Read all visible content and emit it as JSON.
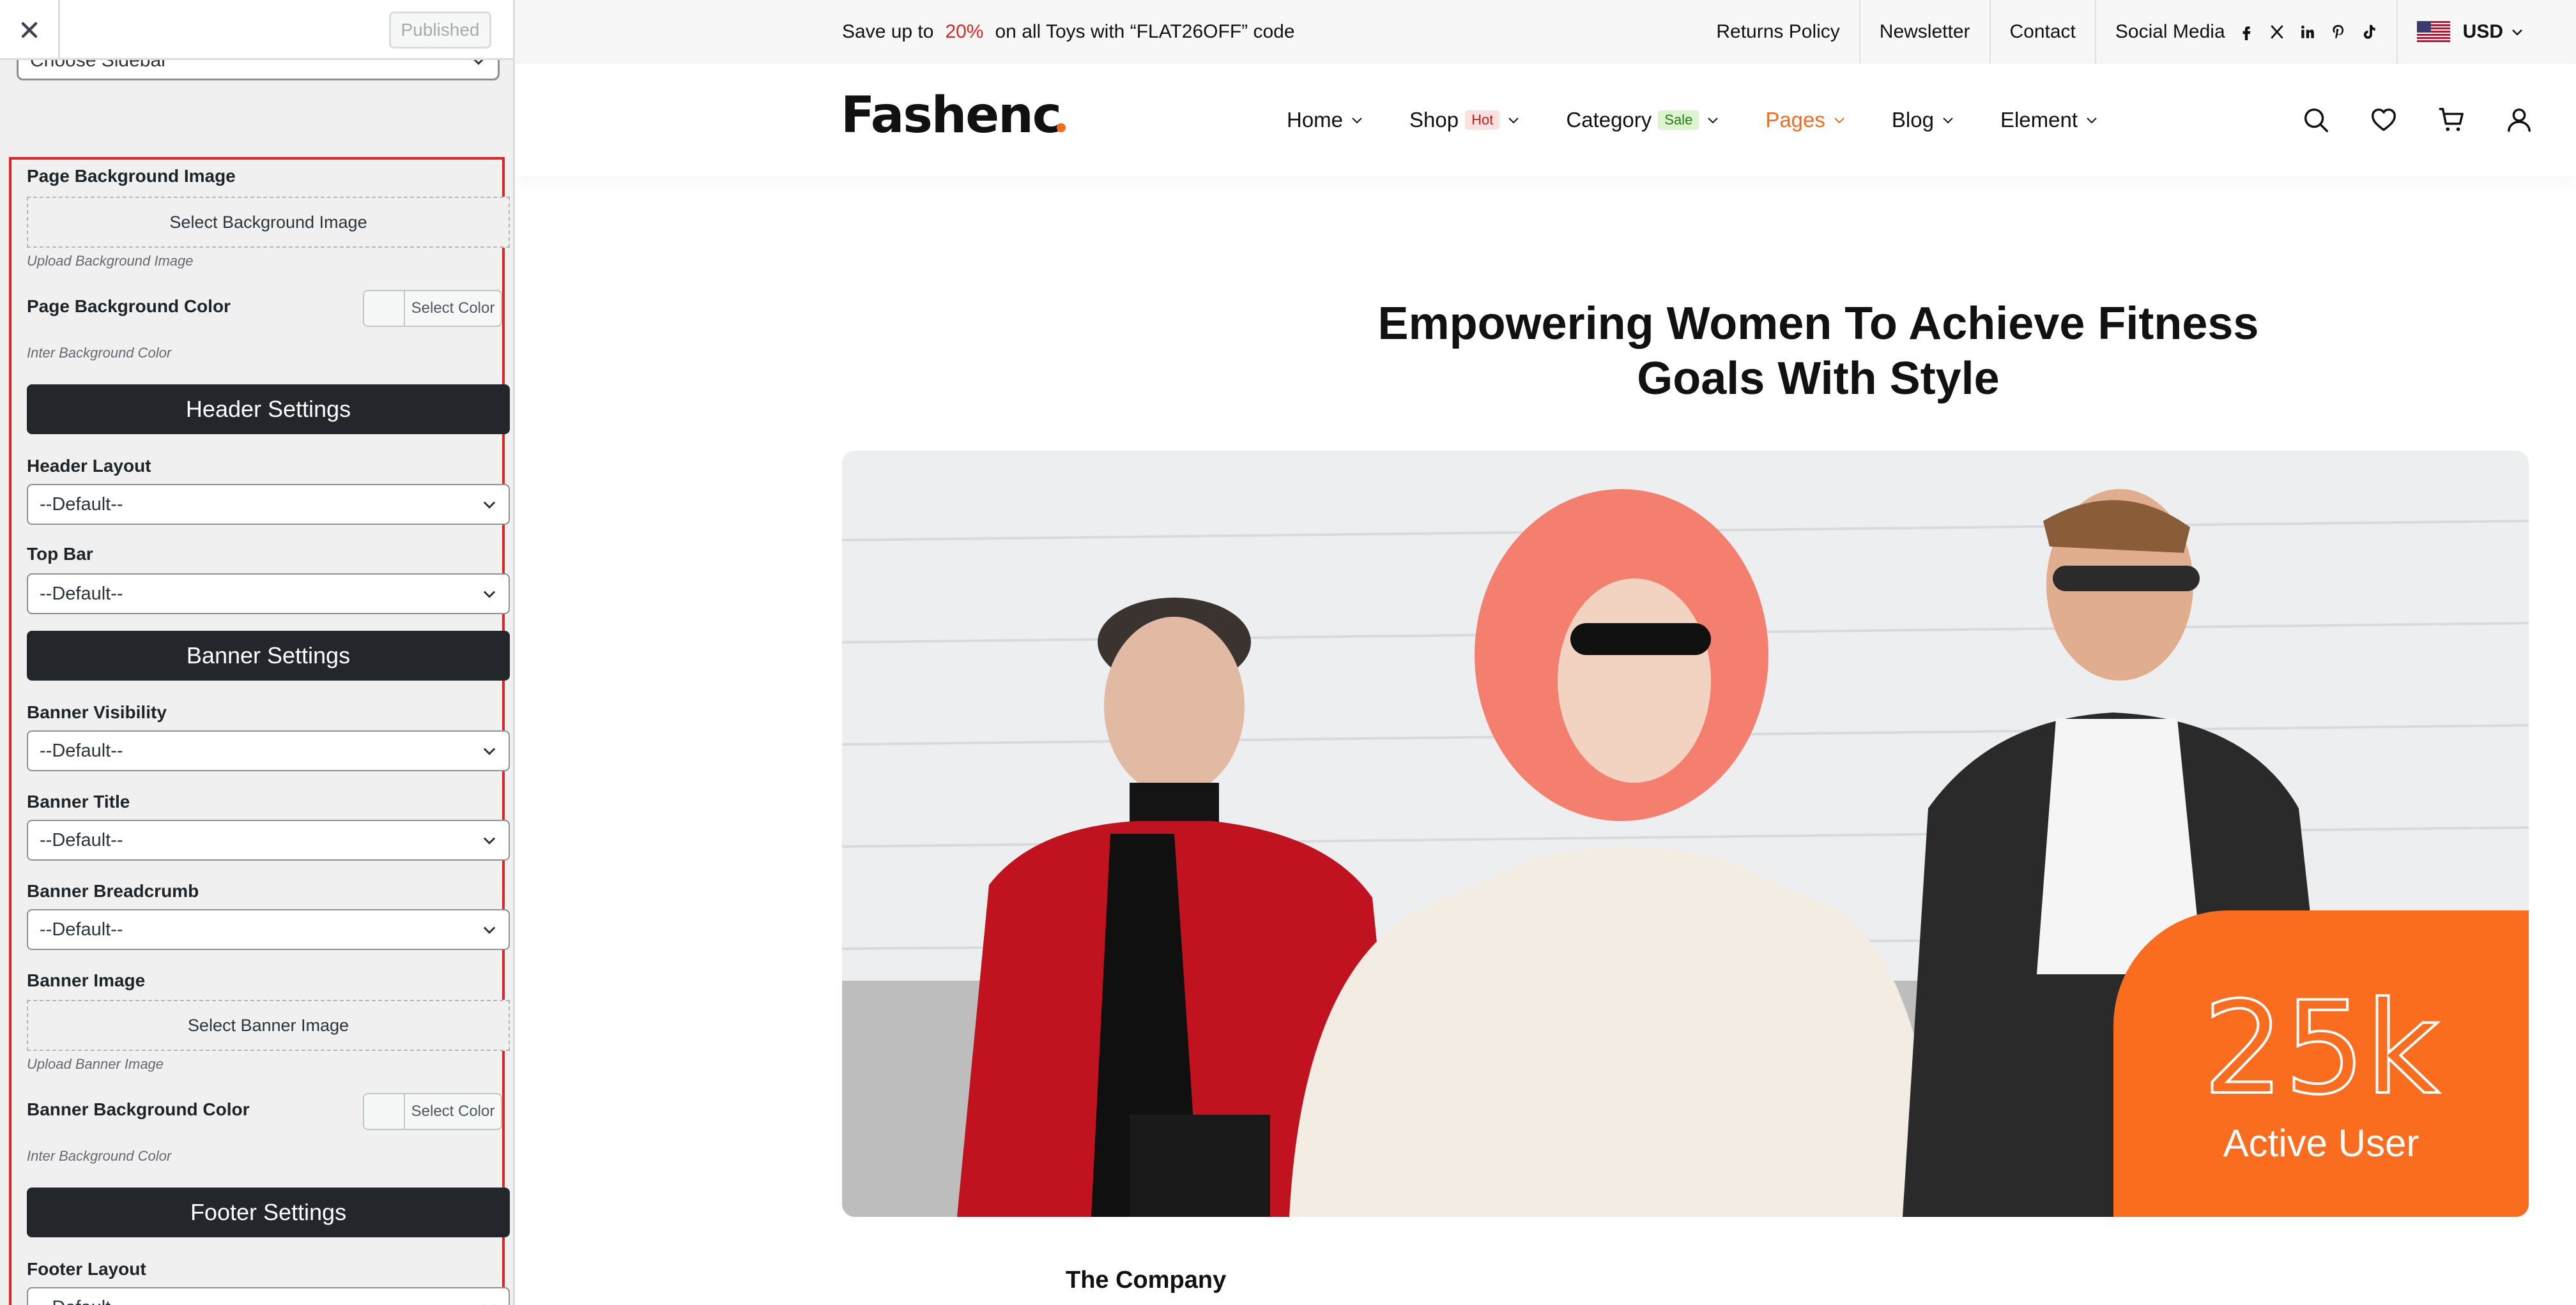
{
  "customizer": {
    "published_label": "Published",
    "choose_sidebar": "Choose Sidebar",
    "page_bg_image": {
      "label": "Page Background Image",
      "button": "Select Background Image",
      "hint": "Upload Background Image"
    },
    "page_bg_color": {
      "label": "Page Background Color",
      "button": "Select Color",
      "hint": "Inter Background Color"
    },
    "header_section": "Header Settings",
    "header_layout": {
      "label": "Header Layout",
      "value": "--Default--"
    },
    "top_bar": {
      "label": "Top Bar",
      "value": "--Default--"
    },
    "banner_section": "Banner Settings",
    "banner_visibility": {
      "label": "Banner Visibility",
      "value": "--Default--"
    },
    "banner_title": {
      "label": "Banner Title",
      "value": "--Default--"
    },
    "banner_breadcrumb": {
      "label": "Banner Breadcrumb",
      "value": "--Default--"
    },
    "banner_image": {
      "label": "Banner Image",
      "button": "Select Banner Image",
      "hint": "Upload Banner Image"
    },
    "banner_bg_color": {
      "label": "Banner Background Color",
      "button": "Select Color",
      "hint": "Inter Background Color"
    },
    "footer_section": "Footer Settings",
    "footer_layout": {
      "label": "Footer Layout",
      "value": "--Default--"
    }
  },
  "site": {
    "promo": {
      "before": "Save up to",
      "highlight": "20%",
      "after": "on all Toys with “FLAT26OFF” code"
    },
    "top_links": [
      "Returns Policy",
      "Newsletter",
      "Contact"
    ],
    "social_label": "Social Media",
    "social_icons": [
      "facebook-icon",
      "x-icon",
      "linkedin-icon",
      "pinterest-icon",
      "tiktok-icon"
    ],
    "currency": "USD",
    "logo": "Fashenc",
    "nav": [
      {
        "label": "Home"
      },
      {
        "label": "Shop",
        "badge": "Hot"
      },
      {
        "label": "Category",
        "badge": "Sale"
      },
      {
        "label": "Pages",
        "active": true
      },
      {
        "label": "Blog"
      },
      {
        "label": "Element"
      }
    ],
    "headline_line1": "Empowering Women To Achieve Fitness",
    "headline_line2": "Goals With Style",
    "stat_number": "25k",
    "stat_label": "Active User",
    "section_title": "The Company"
  },
  "colors": {
    "accent": "#fa6d1f",
    "promo_highlight": "#e02424",
    "hot_badge": "#c81e1e",
    "sale_badge": "#2a7a16",
    "dark_bar": "#23272b",
    "panel_outline": "#e02424"
  }
}
